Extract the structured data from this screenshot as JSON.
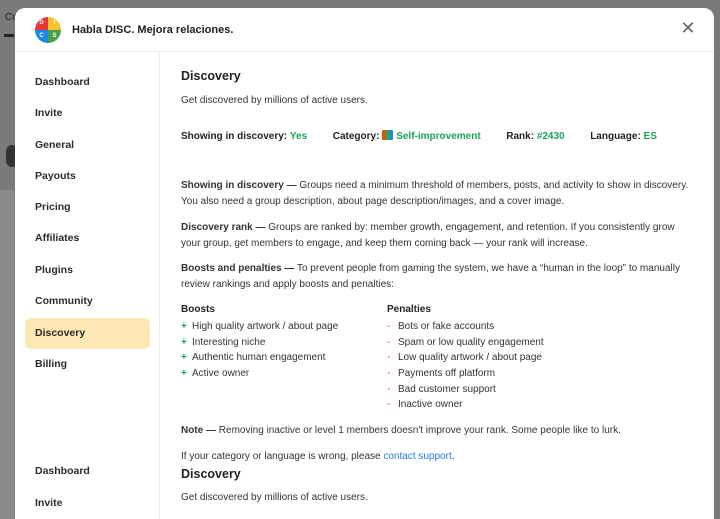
{
  "background": {
    "tab_label": "Co"
  },
  "modal": {
    "title": "Habla DISC. Mejora relaciones.",
    "logo_letters": [
      "D",
      "I",
      "C",
      "S"
    ],
    "close_icon": "close-icon"
  },
  "sidebar": {
    "items": [
      {
        "label": "Dashboard"
      },
      {
        "label": "Invite"
      },
      {
        "label": "General"
      },
      {
        "label": "Payouts"
      },
      {
        "label": "Pricing"
      },
      {
        "label": "Affiliates"
      },
      {
        "label": "Plugins"
      },
      {
        "label": "Community"
      },
      {
        "label": "Discovery",
        "active": true
      },
      {
        "label": "Billing"
      },
      {
        "label": "Dashboard"
      },
      {
        "label": "Invite"
      }
    ]
  },
  "discovery": {
    "title": "Discovery",
    "subtitle": "Get discovered by millions of active users.",
    "status": {
      "showing_label": "Showing in discovery:",
      "showing_value": "Yes",
      "category_label": "Category:",
      "category_value": "Self-improvement",
      "rank_label": "Rank:",
      "rank_value": "#2430",
      "language_label": "Language:",
      "language_value": "ES"
    },
    "showing_heading": "Showing in discovery —",
    "showing_text": "Groups need a minimum threshold of members, posts, and activity to show in discovery. You also need a group description, about page description/images, and a cover image.",
    "rank_heading": "Discovery rank —",
    "rank_text": "Groups are ranked by: member growth, engagement, and retention. If you consistently grow your group, get members to engage, and keep them coming back — your rank will increase.",
    "boosts_heading": "Boosts and penalties —",
    "boosts_text": "To prevent people from gaming the system, we have a “human in the loop” to manually review rankings and apply boosts and penalties:",
    "boosts_title": "Boosts",
    "boosts": [
      "High quality artwork / about page",
      "Interesting niche",
      "Authentic human engagement",
      "Active owner"
    ],
    "penalties_title": "Penalties",
    "penalties": [
      "Bots or fake accounts",
      "Spam or low quality engagement",
      "Low quality artwork / about page",
      "Payments off platform",
      "Bad customer support",
      "Inactive owner"
    ],
    "note_heading": "Note —",
    "note_text": "Removing inactive or level 1 members doesn't improve your rank. Some people like to lurk.",
    "support_prefix": "If your category or language is wrong, please",
    "support_link": "contact support",
    "support_suffix": "."
  },
  "discovery_repeat": {
    "title": "Discovery",
    "subtitle": "Get discovered by millions of active users."
  }
}
